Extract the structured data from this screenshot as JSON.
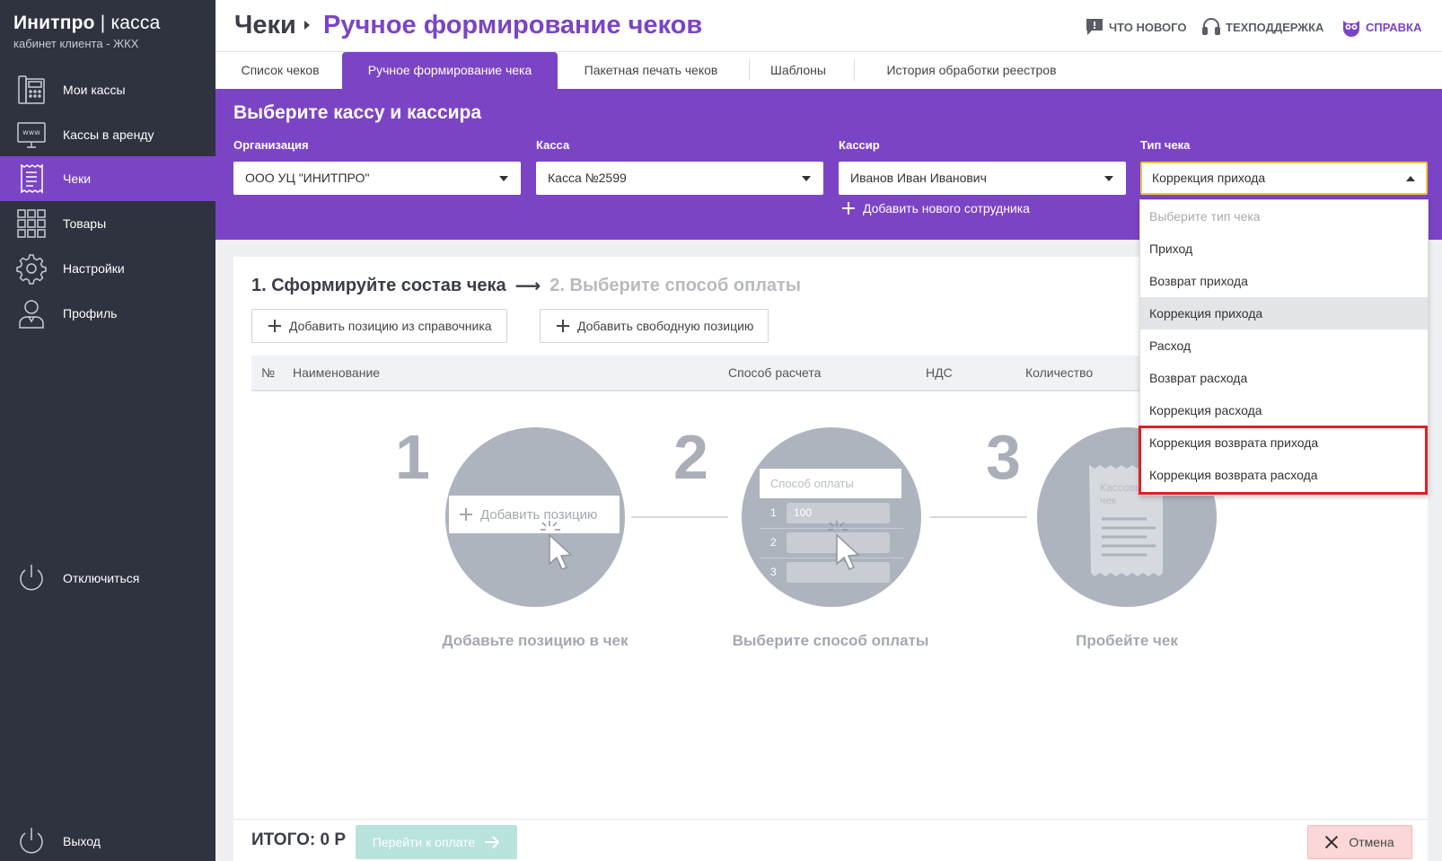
{
  "brand": {
    "name": "Инитпро",
    "product": "касса",
    "subtitle": "кабинет клиента - ЖКХ"
  },
  "sidebar": {
    "items": [
      {
        "label": "Мои кассы",
        "icon": "cash-register-icon"
      },
      {
        "label": "Кассы в аренду",
        "icon": "www-monitor-icon"
      },
      {
        "label": "Чеки",
        "icon": "receipt-icon",
        "active": true
      },
      {
        "label": "Товары",
        "icon": "grid-icon"
      },
      {
        "label": "Настройки",
        "icon": "gear-icon"
      },
      {
        "label": "Профиль",
        "icon": "user-icon"
      }
    ],
    "disconnect_label": "Отключиться",
    "logout_label": "Выход"
  },
  "header": {
    "breadcrumb_root": "Чеки",
    "page_title": "Ручное формирование чеков",
    "links": [
      {
        "label": "ЧТО НОВОГО",
        "icon": "news-icon"
      },
      {
        "label": "ТЕХПОДДЕРЖКА",
        "icon": "headset-icon"
      },
      {
        "label": "СПРАВКА",
        "icon": "owl-icon"
      }
    ]
  },
  "tabs": [
    {
      "label": "Список чеков"
    },
    {
      "label": "Ручное формирование чека",
      "active": true
    },
    {
      "label": "Пакетная печать чеков"
    },
    {
      "label": "Шаблоны"
    },
    {
      "label": "История обработки реестров"
    }
  ],
  "panel": {
    "title": "Выберите кассу и кассира",
    "fields": [
      {
        "label": "Организация",
        "value": "ООО УЦ \"ИНИТПРО\""
      },
      {
        "label": "Касса",
        "value": "Касса №2599"
      },
      {
        "label": "Кассир",
        "value": "Иванов Иван Иванович"
      },
      {
        "label": "Тип чека",
        "value": "Коррекция прихода"
      }
    ],
    "add_employee_label": "Добавить нового сотрудника"
  },
  "receipt_type_dropdown": {
    "placeholder": "Выберите тип чека",
    "options": [
      "Приход",
      "Возврат прихода",
      "Коррекция прихода",
      "Расход",
      "Возврат расхода",
      "Коррекция расхода",
      "Коррекция возврата прихода",
      "Коррекция возврата расхода"
    ],
    "selected": "Коррекция прихода"
  },
  "main": {
    "step1": "1. Сформируйте состав чека",
    "step2": "2. Выберите способ оплаты",
    "add_from_catalog_label": "Добавить позицию из справочника",
    "add_free_label": "Добавить свободную позицию",
    "table_headers": [
      "№",
      "Наименование",
      "Способ расчета",
      "НДС",
      "Количество"
    ],
    "illustration": {
      "numbers": [
        "1",
        "2",
        "3"
      ],
      "add_position_label": "Добавить позицию",
      "payment_method_label": "Способ оплаты",
      "payment_rows": [
        "1",
        "2",
        "3"
      ],
      "payment_value": "100",
      "receipt_label": "Кассовый чек",
      "captions": [
        "Добавьте позицию в чек",
        "Выберите способ оплаты",
        "Пробейте чек"
      ]
    }
  },
  "footer": {
    "total_label": "ИТОГО: 0 Р",
    "pay_label": "Перейти к оплате",
    "cancel_label": "Отмена"
  },
  "colors": {
    "accent": "#7b44c5",
    "sidebar": "#2f323f",
    "highlight": "#e02023",
    "pay_disabled": "#b9e3dd"
  }
}
